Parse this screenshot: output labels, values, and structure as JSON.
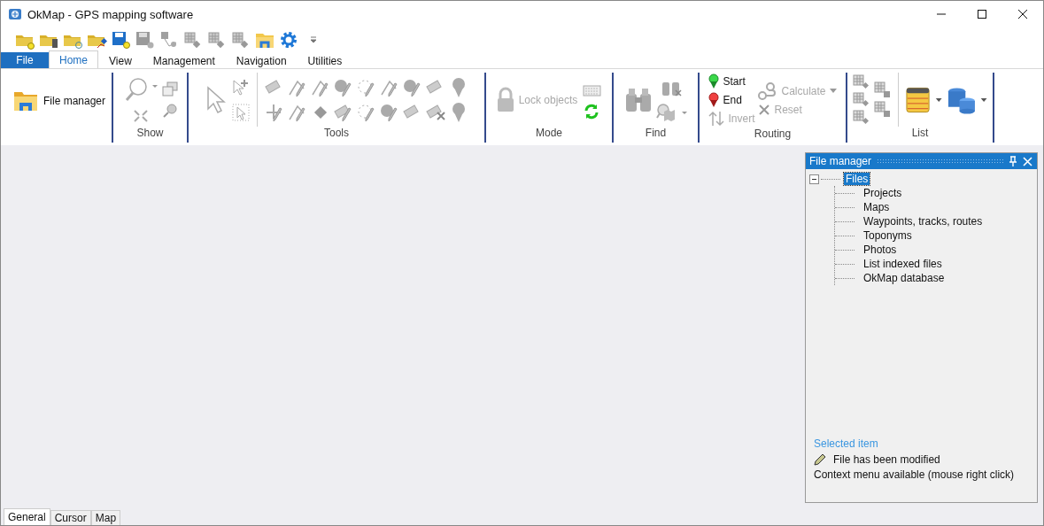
{
  "window": {
    "title": "OkMap - GPS mapping software"
  },
  "ribbon_tabs": [
    {
      "label": "File",
      "kind": "file",
      "selected": false
    },
    {
      "label": "Home",
      "kind": "tab",
      "selected": true
    },
    {
      "label": "View",
      "kind": "tab",
      "selected": false
    },
    {
      "label": "Management",
      "kind": "tab",
      "selected": false
    },
    {
      "label": "Navigation",
      "kind": "tab",
      "selected": false
    },
    {
      "label": "Utilities",
      "kind": "tab",
      "selected": false
    }
  ],
  "ribbon": {
    "file_manager_button": {
      "label": "File manager"
    },
    "groups": [
      {
        "kind": "show",
        "label": "Show"
      },
      {
        "kind": "tools",
        "label": "Tools"
      },
      {
        "kind": "mode",
        "label": "Mode",
        "buttons": [
          {
            "label": "Lock objects",
            "disabled": true
          }
        ]
      },
      {
        "kind": "find",
        "label": "Find"
      },
      {
        "kind": "routing",
        "label": "Routing",
        "buttons": [
          {
            "label": "Start",
            "disabled": false
          },
          {
            "label": "End",
            "disabled": false
          },
          {
            "label": "Invert",
            "disabled": true
          },
          {
            "label": "Calculate",
            "disabled": true
          },
          {
            "label": "Reset",
            "disabled": true
          }
        ]
      },
      {
        "kind": "list",
        "label": "List"
      }
    ]
  },
  "file_manager": {
    "title": "File manager",
    "tree": {
      "label": "Files",
      "expanded": true,
      "selected": true,
      "children": [
        {
          "label": "Projects"
        },
        {
          "label": "Maps"
        },
        {
          "label": "Waypoints, tracks, routes"
        },
        {
          "label": "Toponyms"
        },
        {
          "label": "Photos"
        },
        {
          "label": "List indexed files"
        },
        {
          "label": "OkMap database"
        }
      ]
    },
    "selected_item_heading": "Selected item",
    "status": "File has been modified",
    "hint": "Context menu available (mouse right click)"
  },
  "bottom_tabs": [
    {
      "label": "General",
      "selected": true
    },
    {
      "label": "Cursor",
      "selected": false
    },
    {
      "label": "Map",
      "selected": false
    }
  ]
}
